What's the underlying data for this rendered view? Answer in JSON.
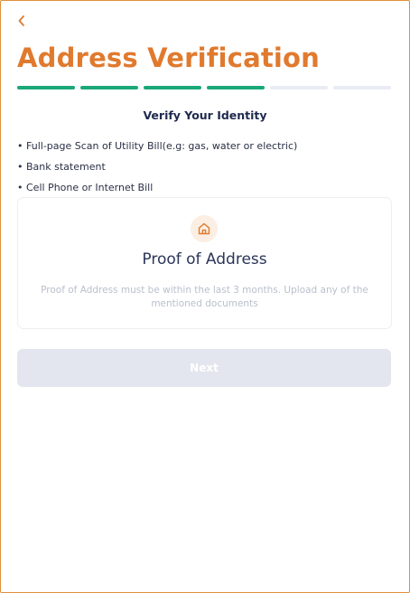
{
  "header": {
    "back_icon": "chevron-left-icon",
    "title": "Address Verification"
  },
  "progress": {
    "total_steps": 6,
    "completed_steps": 4,
    "complete_color": "#1aa87a",
    "pending_color": "#e9ecf5"
  },
  "section": {
    "subtitle": "Verify Your Identity",
    "documents": [
      "Full-page Scan of Utility Bill(e.g: gas, water or electric)",
      "Bank statement",
      "Cell Phone or Internet Bill"
    ]
  },
  "upload_card": {
    "icon": "home-icon",
    "title": "Proof of Address",
    "description": "Proof of Address must be within the last 3 months. Upload any of the mentioned documents"
  },
  "footer": {
    "next_label": "Next",
    "next_disabled": true
  },
  "colors": {
    "accent": "#e07a2e",
    "frame_border": "#e0903a",
    "heading_text": "#1f2a4d",
    "disabled_button": "#e3e6ee"
  }
}
